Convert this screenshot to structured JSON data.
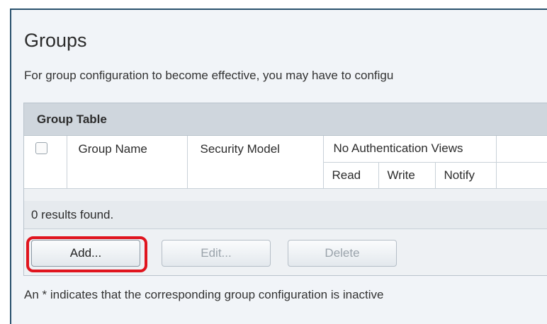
{
  "page": {
    "title": "Groups",
    "description": "For group configuration to become effective, you may have to configu",
    "footnote": "An * indicates that the corresponding group configuration is inactive"
  },
  "group_table": {
    "heading": "Group Table",
    "columns": {
      "group_name": "Group Name",
      "security_model": "Security Model",
      "no_auth_views": "No Authentication Views",
      "read": "Read",
      "write": "Write",
      "notify": "Notify"
    },
    "results_text": "0 results found."
  },
  "buttons": {
    "add": "Add...",
    "edit": "Edit...",
    "delete": "Delete"
  },
  "colors": {
    "highlight": "#e0141e",
    "frame_border": "#29516d"
  }
}
